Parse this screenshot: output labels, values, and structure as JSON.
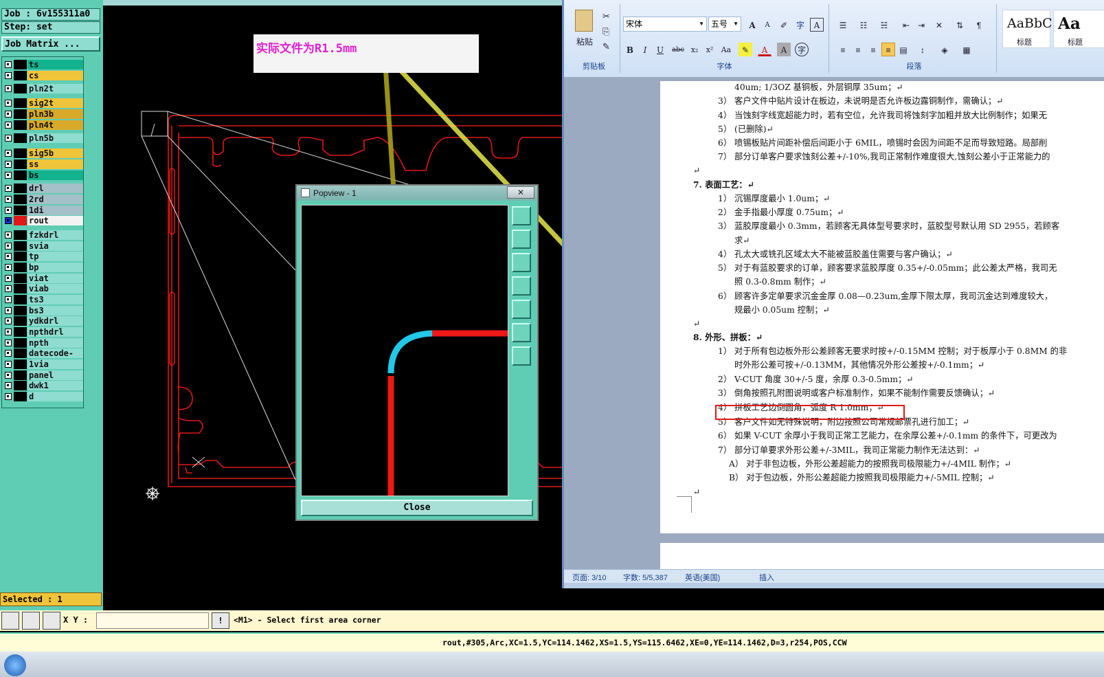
{
  "left_panel": {
    "job_label": "Job : 6v155311a0",
    "step_label": "Step: set",
    "job_matrix_button": "Job Matrix ...",
    "selected_label": "Selected : 1",
    "layers": [
      {
        "name": "ts",
        "color": "#12b28e"
      },
      {
        "name": "cs",
        "color": "#f0c43a"
      },
      {
        "name": "pln2t",
        "color": "#8fdcd0"
      },
      {
        "name": "sig2t",
        "color": "#f0c43a"
      },
      {
        "name": "pln3b",
        "color": "#d9a92a"
      },
      {
        "name": "pln4t",
        "color": "#d9a92a"
      },
      {
        "name": "pln5b",
        "color": "#8fdcd0"
      },
      {
        "name": "sig5b",
        "color": "#f0c43a"
      },
      {
        "name": "ss",
        "color": "#f0c43a"
      },
      {
        "name": "bs",
        "color": "#12b28e"
      },
      {
        "name": "drl",
        "color": "#a5c0c8"
      },
      {
        "name": "2rd",
        "color": "#a5c0c8"
      },
      {
        "name": "1di",
        "color": "#a5c0c8"
      },
      {
        "name": "rout",
        "color": "#f2f2f2"
      },
      {
        "name": "fzkdrl",
        "color": "#8fdcd0"
      },
      {
        "name": "svia",
        "color": "#8fdcd0"
      },
      {
        "name": "tp",
        "color": "#8fdcd0"
      },
      {
        "name": "bp",
        "color": "#8fdcd0"
      },
      {
        "name": "viat",
        "color": "#8fdcd0"
      },
      {
        "name": "viab",
        "color": "#8fdcd0"
      },
      {
        "name": "ts3",
        "color": "#8fdcd0"
      },
      {
        "name": "bs3",
        "color": "#8fdcd0"
      },
      {
        "name": "ydkdrl",
        "color": "#8fdcd0"
      },
      {
        "name": "npthdrl",
        "color": "#8fdcd0"
      },
      {
        "name": "npth",
        "color": "#8fdcd0"
      },
      {
        "name": "datecode-bs",
        "color": "#8fdcd0"
      },
      {
        "name": "1via",
        "color": "#8fdcd0"
      },
      {
        "name": "panel",
        "color": "#8fdcd0"
      },
      {
        "name": "dwk1",
        "color": "#8fdcd0"
      },
      {
        "name": "d",
        "color": "#8fdcd0"
      }
    ]
  },
  "annotation": {
    "text": "实际文件为R1.5mm",
    "color": "#e020d0"
  },
  "popview": {
    "title": "Popview - 1",
    "close_button": "Close"
  },
  "cmd": {
    "xy_label": "X Y :",
    "prompt": "<M1> - Select first area corner",
    "status_line": "rout,#305,Arc,XC=1.5,YC=114.1462,XS=1.5,YS=115.6462,XE=0,YE=114.1462,D=3,r254,POS,CCW"
  },
  "word": {
    "ribbon": {
      "paste_label": "粘贴",
      "clipboard_group": "剪贴板",
      "font_name": "宋体",
      "font_size": "五号",
      "font_group": "字体",
      "paragraph_group": "段落",
      "style_sample": "AaBbC",
      "style_label": "标题",
      "style_sample2": "Aa",
      "style_label2": "标题"
    },
    "doc_lines": [
      {
        "text": "40um; 1/3OZ 基铜板，外层铜厚 35um；↵",
        "indent": 1
      },
      {
        "text": "3） 客户文件中贴片设计在板边，未说明是否允许板边露铜制作，需确认；↵",
        "indent": 0
      },
      {
        "text": "4） 当蚀刻字线宽超能力时，若有空位，允许我司将蚀刻字加粗并放大比例制作；如果无",
        "indent": 0
      },
      {
        "text": "5） (已删除)↵",
        "indent": 0
      },
      {
        "text": "6） 喷锡板贴片间距补偿后间距小于 6MIL，喷锡时会因为间距不足而导致短路。局部削",
        "indent": 0
      },
      {
        "text": "7） 部分订单客户要求蚀刻公差+/-10%,我司正常制作难度很大,蚀刻公差小于正常能力的",
        "indent": 0
      },
      {
        "text": "↵",
        "indent": -1
      },
      {
        "text": "7. 表面工艺：↵",
        "indent": -2
      },
      {
        "text": "1） 沉锡厚度最小 1.0um；↵",
        "indent": 0
      },
      {
        "text": "2） 金手指最小厚度 0.75um；↵",
        "indent": 0
      },
      {
        "text": "3） 蓝胶厚度最小 0.3mm，若顾客无具体型号要求时，蓝胶型号默认用 SD 2955，若顾客",
        "indent": 0
      },
      {
        "text": "求↵",
        "indent": 1
      },
      {
        "text": "4） 孔太大或铣孔区域太大不能被蓝胶盖住需要与客户确认；↵",
        "indent": 0
      },
      {
        "text": "5） 对于有蓝胶要求的订单，顾客要求蓝胶厚度 0.35+/-0.05mm；此公差太严格，我司无",
        "indent": 0
      },
      {
        "text": "照 0.3-0.8mm 制作；↵",
        "indent": 1
      },
      {
        "text": "6） 顾客许多定单要求沉金金厚 0.08—0.23um,金厚下限太厚，我司沉金达到难度较大，",
        "indent": 0
      },
      {
        "text": "规最小 0.05um 控制；↵",
        "indent": 1
      },
      {
        "text": "↵",
        "indent": -1
      },
      {
        "text": "8. 外形、拼板：↵",
        "indent": -2
      },
      {
        "text": "1） 对于所有包边板外形公差顾客无要求时按+/-0.15MM 控制；对于板厚小于 0.8MM 的非",
        "indent": 0
      },
      {
        "text": "时外形公差可按+/-0.13MM，其他情况外形公差按+/-0.1mm；↵",
        "indent": 1
      },
      {
        "text": "2） V-CUT 角度 30+/-5 度，余厚 0.3-0.5mm；↵",
        "indent": 0
      },
      {
        "text": "3） 倒角按照孔附图说明或客户标准制作，如果不能制作需要反馈确认；↵",
        "indent": 0
      },
      {
        "text": "4） 拼板工艺边倒圆角，弧度 R 1.0mm；↵",
        "indent": 0
      },
      {
        "text": "5） 客户文件如无特殊说明，附边按照公司常规邮票孔进行加工；↵",
        "indent": 0
      },
      {
        "text": "6） 如果 V-CUT 余厚小于我司正常工艺能力，在余厚公差+/-0.1mm 的条件下，可更改为",
        "indent": 0
      },
      {
        "text": "7） 部分订单要求外形公差+/-3MIL，我司正常能力制作无法达到：↵",
        "indent": 0
      },
      {
        "text": "A） 对于非包边板，外形公差超能力的按照我司极限能力+/-4MIL 制作；↵",
        "indent": 2
      },
      {
        "text": "B） 对于包边板，外形公差超能力按照我司极限能力+/-5MIL 控制；↵",
        "indent": 2
      },
      {
        "text": "↵",
        "indent": -1
      }
    ],
    "status": {
      "page": "页面: 3/10",
      "words": "字数: 5/5,387",
      "language": "英语(美国)",
      "mode": "插入"
    }
  }
}
